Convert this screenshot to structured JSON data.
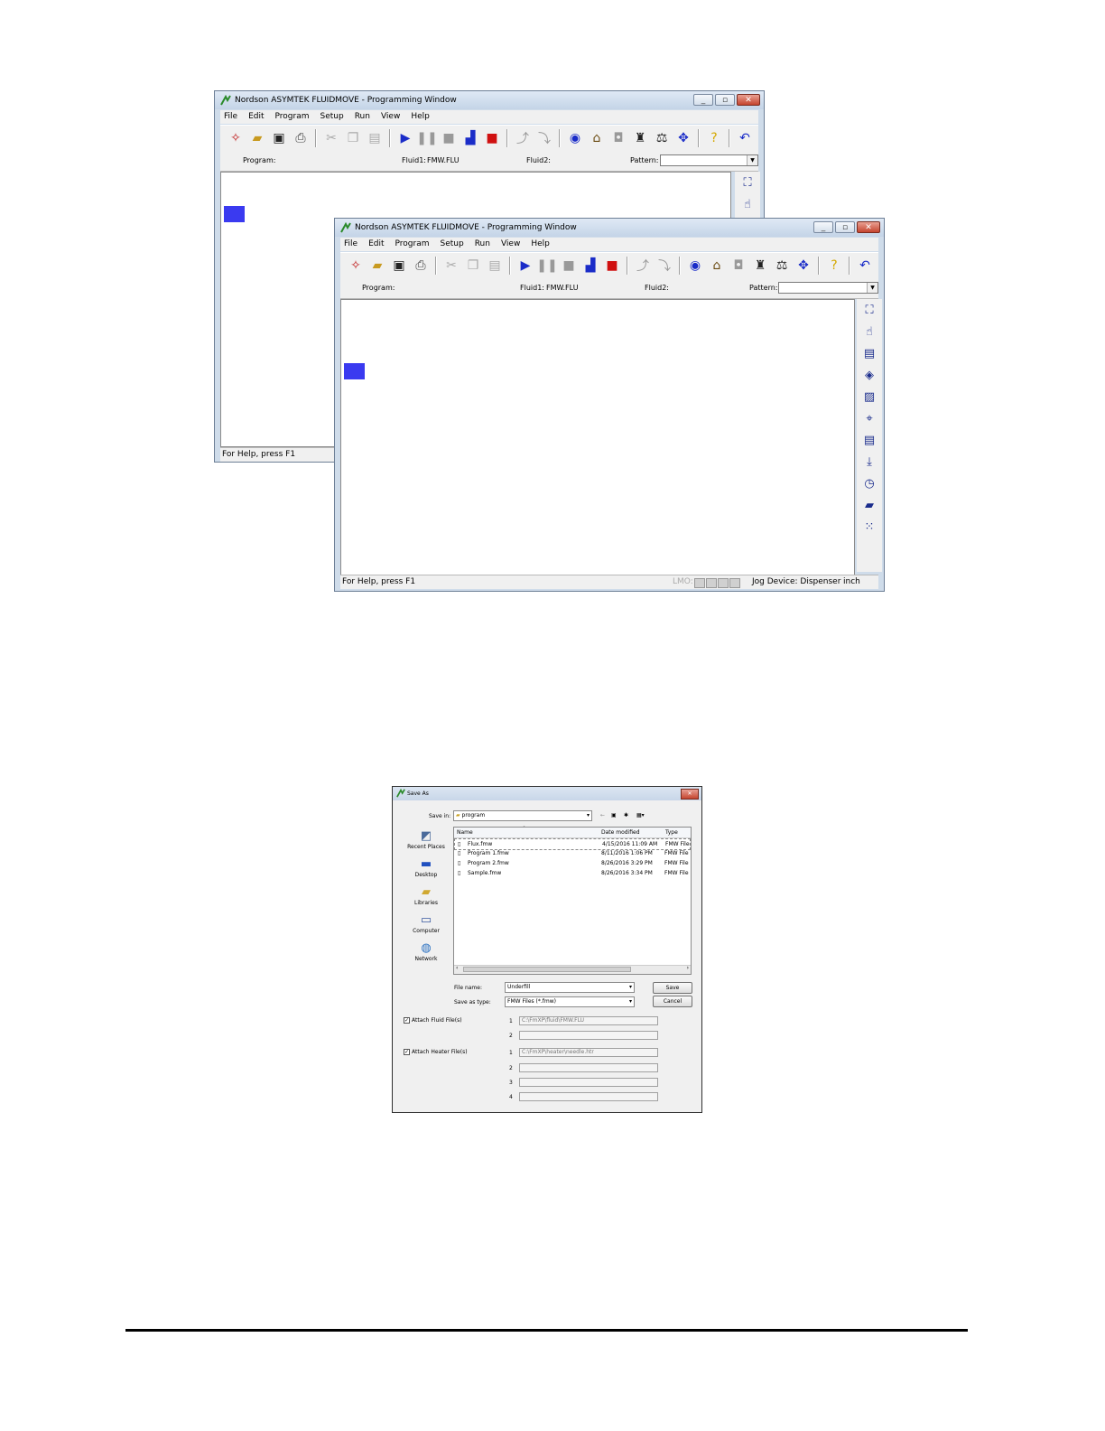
{
  "window_back": {
    "title": "Nordson ASYMTEK FLUIDMOVE - Programming Window",
    "menu": [
      "File",
      "Edit",
      "Program",
      "Setup",
      "Run",
      "View",
      "Help"
    ],
    "program_label": "Program:",
    "fluid1_label": "Fluid1:",
    "fluid1_value": "FMW.FLU",
    "fluid2_label": "Fluid2:",
    "pattern_label": "Pattern:",
    "status": "For Help, press F1"
  },
  "window_front": {
    "title": "Nordson ASYMTEK FLUIDMOVE - Programming Window",
    "menu": [
      "File",
      "Edit",
      "Program",
      "Setup",
      "Run",
      "View",
      "Help"
    ],
    "program_label": "Program:",
    "fluid1_label": "Fluid1:",
    "fluid1_value": "FMW.FLU",
    "fluid2_label": "Fluid2:",
    "pattern_label": "Pattern:",
    "status": "For Help, press F1",
    "status_lmo": "LMO:",
    "status_jog": "Jog Device: Dispenser",
    "status_units": "inch"
  },
  "save_as": {
    "title": "Save As",
    "save_in_label": "Save in:",
    "save_in_value": "program",
    "places": [
      "Recent Places",
      "Desktop",
      "Libraries",
      "Computer",
      "Network"
    ],
    "columns": [
      "Name",
      "Date modified",
      "Type"
    ],
    "files": [
      {
        "name": "Flux.fmw",
        "date": "4/15/2016 11:09 AM",
        "type": "FMW File"
      },
      {
        "name": "Program 1.fmw",
        "date": "8/11/2016 1:06 PM",
        "type": "FMW File"
      },
      {
        "name": "Program 2.fmw",
        "date": "8/26/2016 3:29 PM",
        "type": "FMW File"
      },
      {
        "name": "Sample.fmw",
        "date": "8/26/2016 3:34 PM",
        "type": "FMW File"
      }
    ],
    "file_name_label": "File name:",
    "file_name_value": "Underfill",
    "save_type_label": "Save as type:",
    "save_type_value": "FMW Files (*.fmw)",
    "save_button": "Save",
    "cancel_button": "Cancel",
    "attach_fluid_label": "Attach Fluid File(s)",
    "attach_fluid_1": "C:\\FmXP\\fluid\\FMW.FLU",
    "attach_heater_label": "Attach Heater File(s)",
    "attach_heater_1": "C:\\FmXP\\heater\\needle.htr",
    "numbers": [
      "1",
      "2",
      "1",
      "2",
      "3",
      "4"
    ]
  },
  "colors": {
    "accent_blue": "#3a3af0",
    "title_gradient": "#c4d4e7",
    "close_red": "#c5452f"
  }
}
